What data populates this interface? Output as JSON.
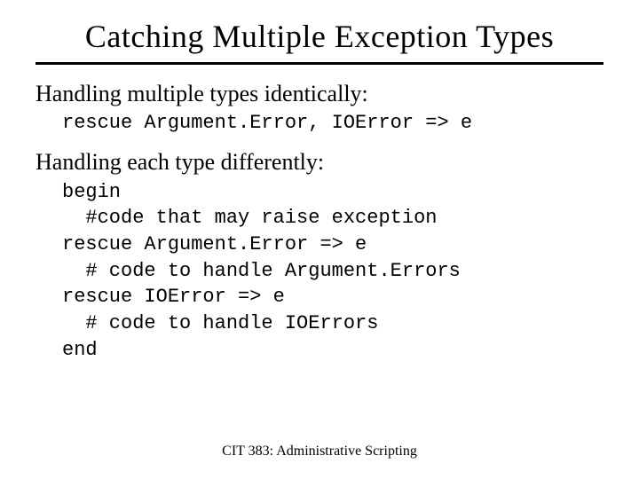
{
  "title": "Catching Multiple Exception Types",
  "section1": {
    "heading": "Handling multiple types identically:",
    "code": "rescue Argument.Error, IOError => e"
  },
  "section2": {
    "heading": "Handling each type differently:",
    "code": "begin\n  #code that may raise exception\nrescue Argument.Error => e\n  # code to handle Argument.Errors\nrescue IOError => e\n  # code to handle IOErrors\nend"
  },
  "footer": "CIT 383: Administrative Scripting"
}
